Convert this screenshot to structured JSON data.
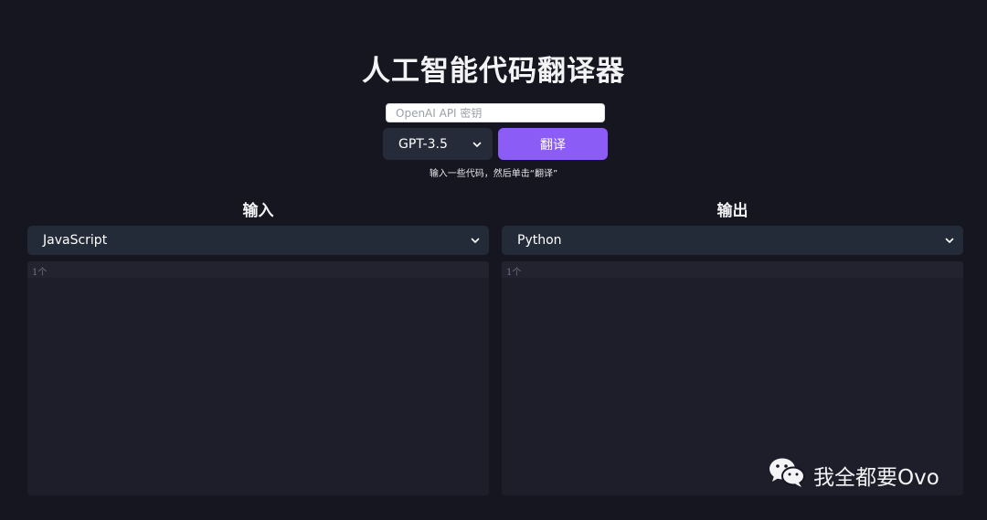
{
  "header": {
    "title": "人工智能代码翻译器"
  },
  "controls": {
    "api_key_placeholder": "OpenAI API 密钥",
    "model_selected": "GPT-3.5",
    "translate_label": "翻译",
    "hint": "输入一些代码，然后单击“翻译”"
  },
  "input_panel": {
    "title": "输入",
    "language": "JavaScript",
    "line_number": "1个"
  },
  "output_panel": {
    "title": "输出",
    "language": "Python",
    "line_number": "1个"
  },
  "watermark": {
    "text": "我全都要Ovo",
    "icon": "wechat-icon"
  },
  "colors": {
    "background": "#15161f",
    "accent": "#8b5cf6",
    "select_bg": "#232a38",
    "editor_bg": "#1d1e29"
  }
}
